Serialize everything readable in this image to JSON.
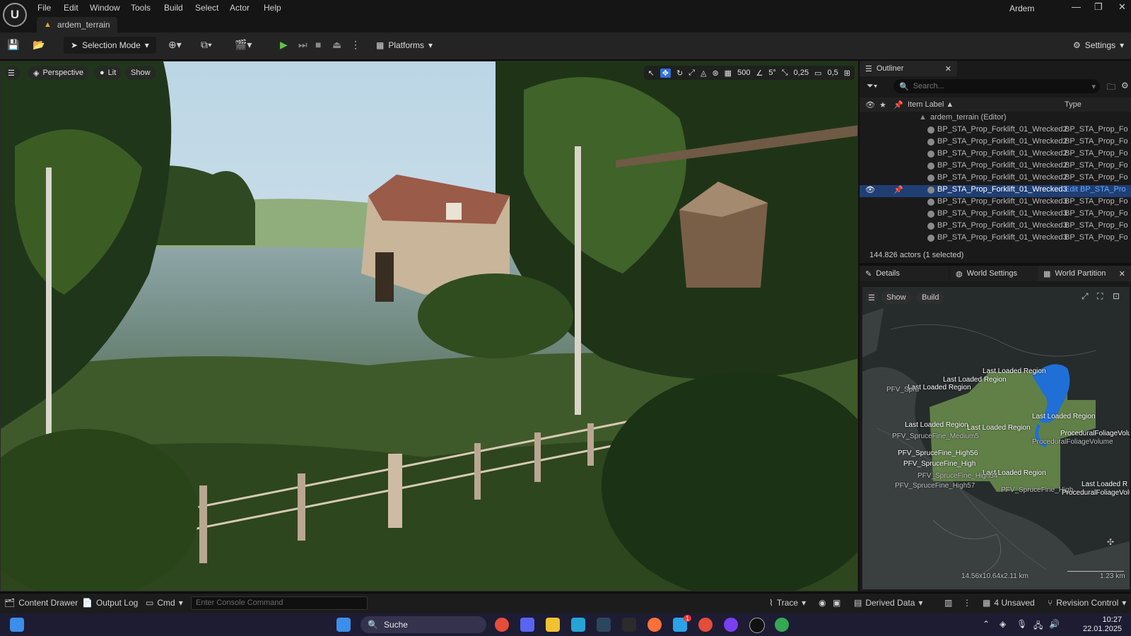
{
  "app": {
    "project_tab": "ardem_terrain",
    "project_name": "Ardem",
    "menu": [
      "File",
      "Edit",
      "Window",
      "Tools",
      "Build",
      "Select",
      "Actor",
      "Help"
    ],
    "window_buttons": [
      "—",
      "❐",
      "✕"
    ]
  },
  "toolbar": {
    "selection_mode": "Selection Mode",
    "platforms": "Platforms",
    "settings": "Settings"
  },
  "viewport": {
    "perspective": "Perspective",
    "lit": "Lit",
    "show": "Show",
    "grid_value": "500",
    "angle_value": "5°",
    "scale_value": "0,25",
    "camera_value": "0,5"
  },
  "outliner": {
    "title": "Outliner",
    "search_placeholder": "Search...",
    "col_label": "Item Label ▲",
    "col_type": "Type",
    "root": "ardem_terrain (Editor)",
    "rows": [
      {
        "name": "BP_STA_Prop_Forklift_01_Wrecked2",
        "type": "BP_STA_Prop_Fo"
      },
      {
        "name": "BP_STA_Prop_Forklift_01_Wrecked2",
        "type": "BP_STA_Prop_Fo"
      },
      {
        "name": "BP_STA_Prop_Forklift_01_Wrecked2",
        "type": "BP_STA_Prop_Fo"
      },
      {
        "name": "BP_STA_Prop_Forklift_01_Wrecked2",
        "type": "BP_STA_Prop_Fo"
      },
      {
        "name": "BP_STA_Prop_Forklift_01_Wrecked2",
        "type": "BP_STA_Prop_Fo"
      },
      {
        "name": "BP_STA_Prop_Forklift_01_Wrecked3",
        "type": "Edit BP_STA_Pro"
      },
      {
        "name": "BP_STA_Prop_Forklift_01_Wrecked3",
        "type": "BP_STA_Prop_Fo"
      },
      {
        "name": "BP_STA_Prop_Forklift_01_Wrecked3",
        "type": "BP_STA_Prop_Fo"
      },
      {
        "name": "BP_STA_Prop_Forklift_01_Wrecked3",
        "type": "BP_STA_Prop_Fo"
      },
      {
        "name": "BP_STA_Prop_Forklift_01_Wrecked3",
        "type": "BP_STA_Prop_Fo"
      }
    ],
    "status": "144.826 actors (1 selected)"
  },
  "details": {
    "tab_details": "Details",
    "tab_world_settings": "World Settings",
    "tab_world_partition": "World Partition",
    "btn_show": "Show",
    "btn_build": "Build",
    "last_loaded": "Last Loaded Region",
    "last_loaded_partial": "Last Loaded R",
    "last_loaded_short": "Last Loaded Region",
    "spruce_medium": "PFV_SpruceFine_Medium5",
    "spruce_high": "PFV_SpruceFine_High56",
    "spruce_high2": "PFV_SpruceFine_High54",
    "spruce_high3": "PFV_SpruceFine_High57",
    "spruce_fine": "PFV_SpruceFine_High",
    "procedural": "ProceduralFoliageVolume",
    "procedural2": "ProceduralFoliageVolume",
    "procedural3": "ProceduralFoliageVolume",
    "pfv_short": "PFV_Spru",
    "size_readout": "14.56x10.64x2.11 km",
    "scale_readout": "1.23 km"
  },
  "statusbar": {
    "content_drawer": "Content Drawer",
    "output_log": "Output Log",
    "cmd": "Cmd",
    "console_placeholder": "Enter Console Command",
    "trace": "Trace",
    "derived_data": "Derived Data",
    "unsaved": "4 Unsaved",
    "revision_control": "Revision Control"
  },
  "taskbar": {
    "search": "Suche",
    "time": "10:27",
    "date": "22.01.2025",
    "notify_badge": "1"
  }
}
